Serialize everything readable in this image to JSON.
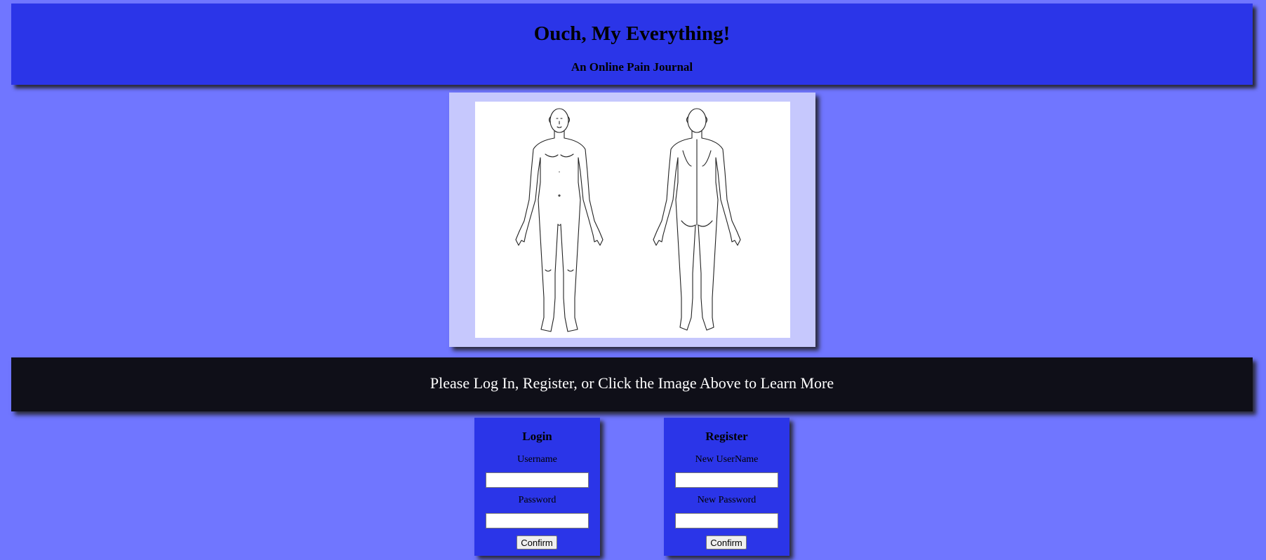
{
  "header": {
    "title": "Ouch, My Everything!",
    "subtitle": "An Online Pain Journal"
  },
  "banner": {
    "text": "Please Log In, Register, or Click the Image Above to Learn More"
  },
  "login": {
    "heading": "Login",
    "username_label": "Username",
    "username_value": "",
    "password_label": "Password",
    "password_value": "",
    "confirm_label": "Confirm"
  },
  "register": {
    "heading": "Register",
    "username_label": "New UserName",
    "username_value": "",
    "password_label": "New Password",
    "password_value": "",
    "confirm_label": "Confirm"
  },
  "colors": {
    "page_background": "#7076ff",
    "header_background": "#2b35e8",
    "figure_frame": "#c6c8fd",
    "banner_background": "#0f0f18",
    "banner_text": "#ffffff"
  },
  "figure": {
    "icon": "body-diagram-front-back-icon"
  }
}
